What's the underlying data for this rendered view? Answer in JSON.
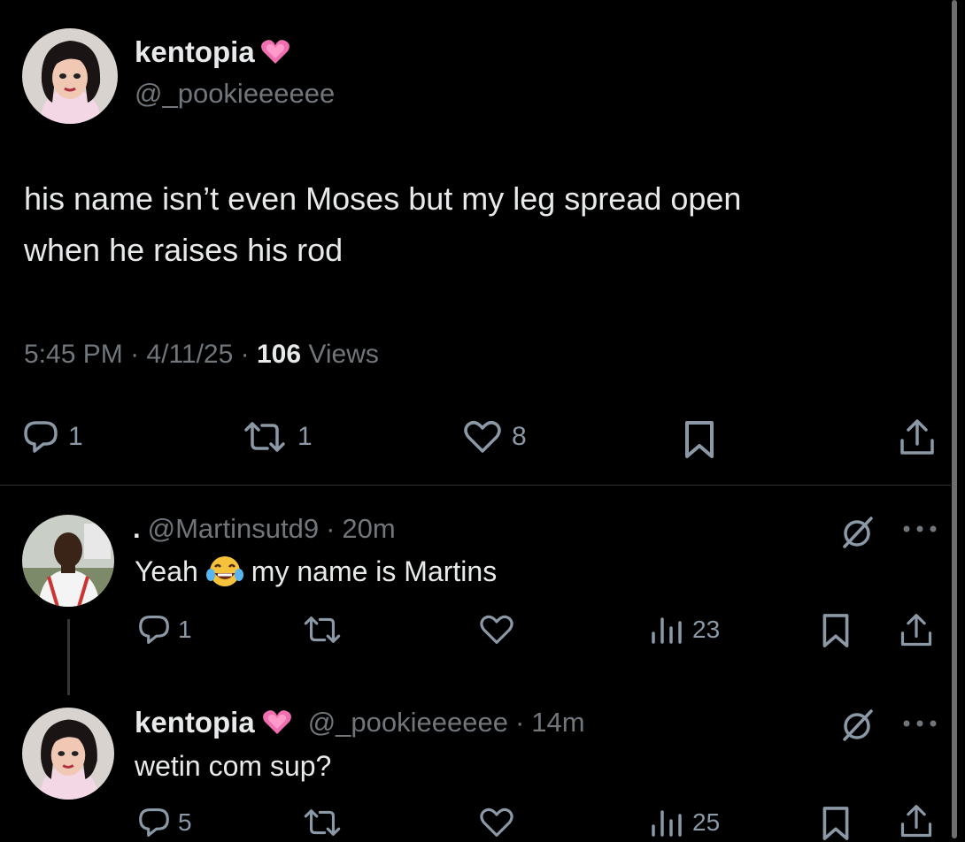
{
  "main_tweet": {
    "display_name": "kentopia",
    "handle": "@_pookieeeeee",
    "text_line1": "his name isn’t even Moses but my leg spread open",
    "text_line2": "when he raises his rod",
    "time": "5:45 PM",
    "sep1": "·",
    "date": "4/11/25",
    "sep2": "·",
    "views_count": "106",
    "views_label": "Views",
    "replies": "1",
    "reposts": "1",
    "likes": "8"
  },
  "reply1": {
    "prefix": ".",
    "handle": "@Martinsutd9",
    "sep": "·",
    "age": "20m",
    "text_a": "Yeah",
    "text_b": "my name is Martins",
    "replies": "1",
    "views": "23"
  },
  "reply2": {
    "display_name": "kentopia",
    "handle": "@_pookieeeeee",
    "sep": "·",
    "age": "14m",
    "text": "wetin com sup?",
    "replies": "5",
    "views": "25"
  },
  "icons": {
    "heart_emoji_color": "#f06fb0",
    "accent_gray": "#71767b",
    "background": "#000000"
  }
}
